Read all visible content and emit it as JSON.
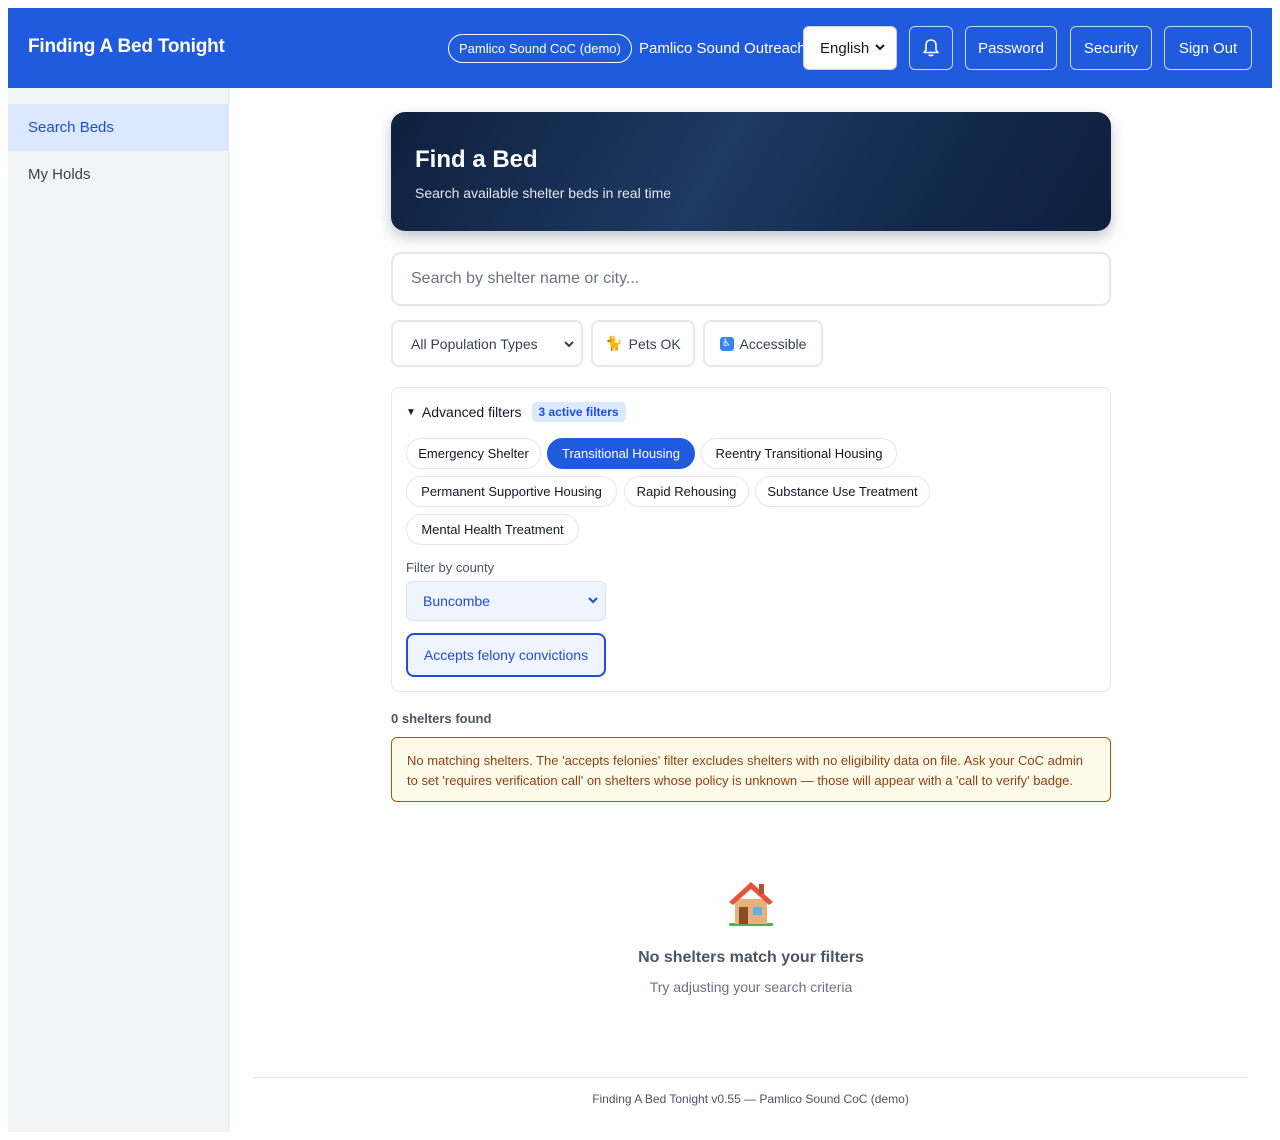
{
  "header": {
    "app_title": "Finding A Bed Tonight",
    "coc_label": "Pamlico Sound CoC (demo)",
    "org_name": "Pamlico Sound Outreach",
    "language": "English",
    "password_label": "Password",
    "security_label": "Security",
    "signout_label": "Sign Out",
    "brand_color": "#1f5bdc"
  },
  "sidebar": {
    "items": [
      {
        "label": "Search Beds",
        "active": true
      },
      {
        "label": "My Holds",
        "active": false
      }
    ]
  },
  "hero": {
    "title": "Find a Bed",
    "subtitle": "Search available shelter beds in real time"
  },
  "search": {
    "placeholder": "Search by shelter name or city..."
  },
  "filters": {
    "population_type": "All Population Types",
    "pets_label": "Pets OK",
    "accessible_label": "Accessible",
    "advanced_label": "Advanced filters",
    "active_count": "3 active filters",
    "shelter_types": [
      {
        "label": "Emergency Shelter",
        "selected": false
      },
      {
        "label": "Transitional Housing",
        "selected": true
      },
      {
        "label": "Reentry Transitional Housing",
        "selected": false
      },
      {
        "label": "Permanent Supportive Housing",
        "selected": false
      },
      {
        "label": "Rapid Rehousing",
        "selected": false
      },
      {
        "label": "Substance Use Treatment",
        "selected": false
      },
      {
        "label": "Mental Health Treatment",
        "selected": false
      }
    ],
    "county_label": "Filter by county",
    "county_value": "Buncombe",
    "felony_label": "Accepts felony convictions"
  },
  "results": {
    "count_text": "0 shelters found",
    "warning": "No matching shelters. The 'accepts felonies' filter excludes shelters with no eligibility data on file. Ask your CoC admin to set 'requires verification call' on shelters whose policy is unknown — those will appear with a 'call to verify' badge.",
    "empty_icon": "house-icon",
    "empty_title": "No shelters match your filters",
    "empty_subtitle": "Try adjusting your search criteria"
  },
  "footer": {
    "text": "Finding A Bed Tonight v0.55 — Pamlico Sound CoC (demo)"
  }
}
